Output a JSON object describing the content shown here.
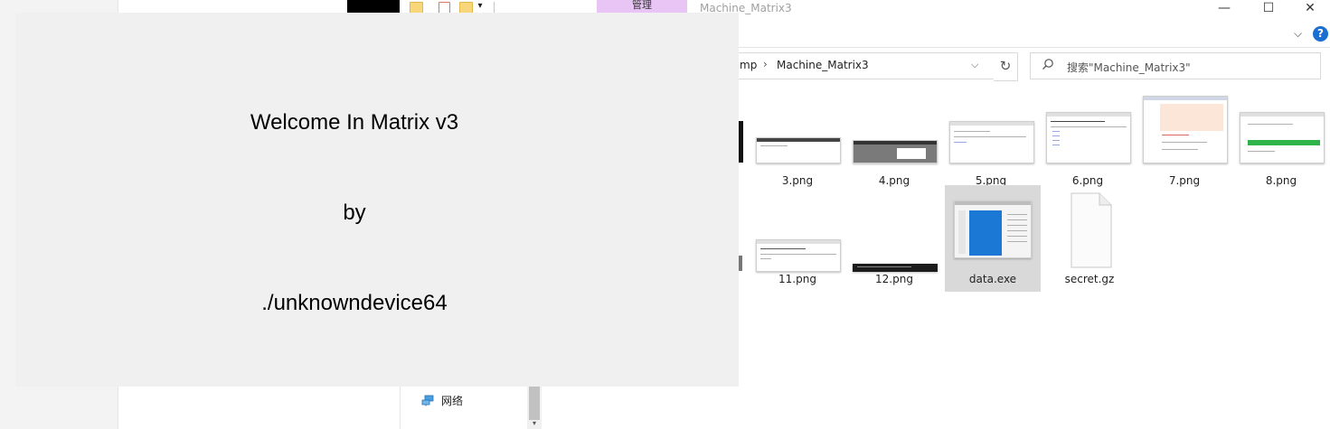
{
  "titlebar": {
    "manage_tab": "管理",
    "window_title": "Machine_Matrix3",
    "minimize": "—",
    "maximize": "☐",
    "close": "✕",
    "ribbon_collapse": "⌵",
    "help": "?",
    "quick_access_dropdown": "▾"
  },
  "address_bar": {
    "prefix": "mp",
    "separator": "›",
    "current": "Machine_Matrix3",
    "dropdown": "⌵",
    "refresh": "↻"
  },
  "search": {
    "icon": "search-icon",
    "placeholder": "搜索\"Machine_Matrix3\""
  },
  "files": [
    {
      "name": "3.png"
    },
    {
      "name": "4.png"
    },
    {
      "name": "5.png"
    },
    {
      "name": "6.png"
    },
    {
      "name": "7.png"
    },
    {
      "name": "8.png"
    },
    {
      "name": "11.png"
    },
    {
      "name": "12.png"
    },
    {
      "name": "data.exe"
    },
    {
      "name": "secret.gz"
    }
  ],
  "nav_pane": {
    "network_label": "网络",
    "scroll_down": "▾"
  },
  "dialog": {
    "line1": "Welcome In Matrix v3",
    "line2": "by",
    "line3": "./unknowndevice64"
  },
  "colors": {
    "dialog_bg": "#f0f0f0",
    "manage_tab": "#e8c5f5",
    "selected_item": "#d9d9d9",
    "help_blue": "#1a6fd1"
  }
}
